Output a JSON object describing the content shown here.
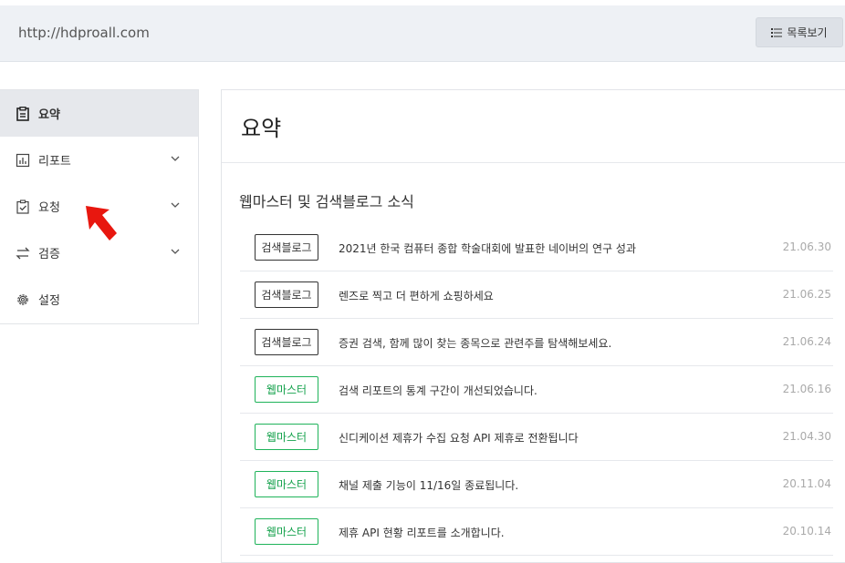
{
  "header": {
    "url": "http://hdproall.com",
    "list_button": "목록보기"
  },
  "sidebar": {
    "items": [
      {
        "label": "요약",
        "icon": "clipboard-icon",
        "active": true
      },
      {
        "label": "리포트",
        "icon": "bar-chart-icon",
        "expandable": true
      },
      {
        "label": "요청",
        "icon": "clipboard-check-icon",
        "expandable": true
      },
      {
        "label": "검증",
        "icon": "swap-arrows-icon",
        "expandable": true
      },
      {
        "label": "설정",
        "icon": "gear-icon"
      }
    ]
  },
  "main": {
    "title": "요약",
    "section_title": "웹마스터 및 검색블로그 소식",
    "news": [
      {
        "tag": "검색블로그",
        "tag_type": "blog",
        "title": "2021년 한국 컴퓨터 종합 학술대회에 발표한 네이버의 연구 성과",
        "date": "21.06.30"
      },
      {
        "tag": "검색블로그",
        "tag_type": "blog",
        "title": "렌즈로 찍고 더 편하게 쇼핑하세요",
        "date": "21.06.25"
      },
      {
        "tag": "검색블로그",
        "tag_type": "blog",
        "title": "증권 검색, 함께 많이 찾는 종목으로 관련주를 탐색해보세요.",
        "date": "21.06.24"
      },
      {
        "tag": "웹마스터",
        "tag_type": "webmaster",
        "title": "검색 리포트의 통계 구간이 개선되었습니다.",
        "date": "21.06.16"
      },
      {
        "tag": "웹마스터",
        "tag_type": "webmaster",
        "title": "신디케이션 제휴가 수집 요청 API 제휴로 전환됩니다",
        "date": "21.04.30"
      },
      {
        "tag": "웹마스터",
        "tag_type": "webmaster",
        "title": "채널 제출 기능이 11/16일 종료됩니다.",
        "date": "20.11.04"
      },
      {
        "tag": "웹마스터",
        "tag_type": "webmaster",
        "title": "제휴 API 현황 리포트를 소개합니다.",
        "date": "20.10.14"
      }
    ]
  },
  "colors": {
    "webmaster_tag": "#1fb35a",
    "blog_tag": "#333333",
    "arrow": "#e8170f"
  }
}
